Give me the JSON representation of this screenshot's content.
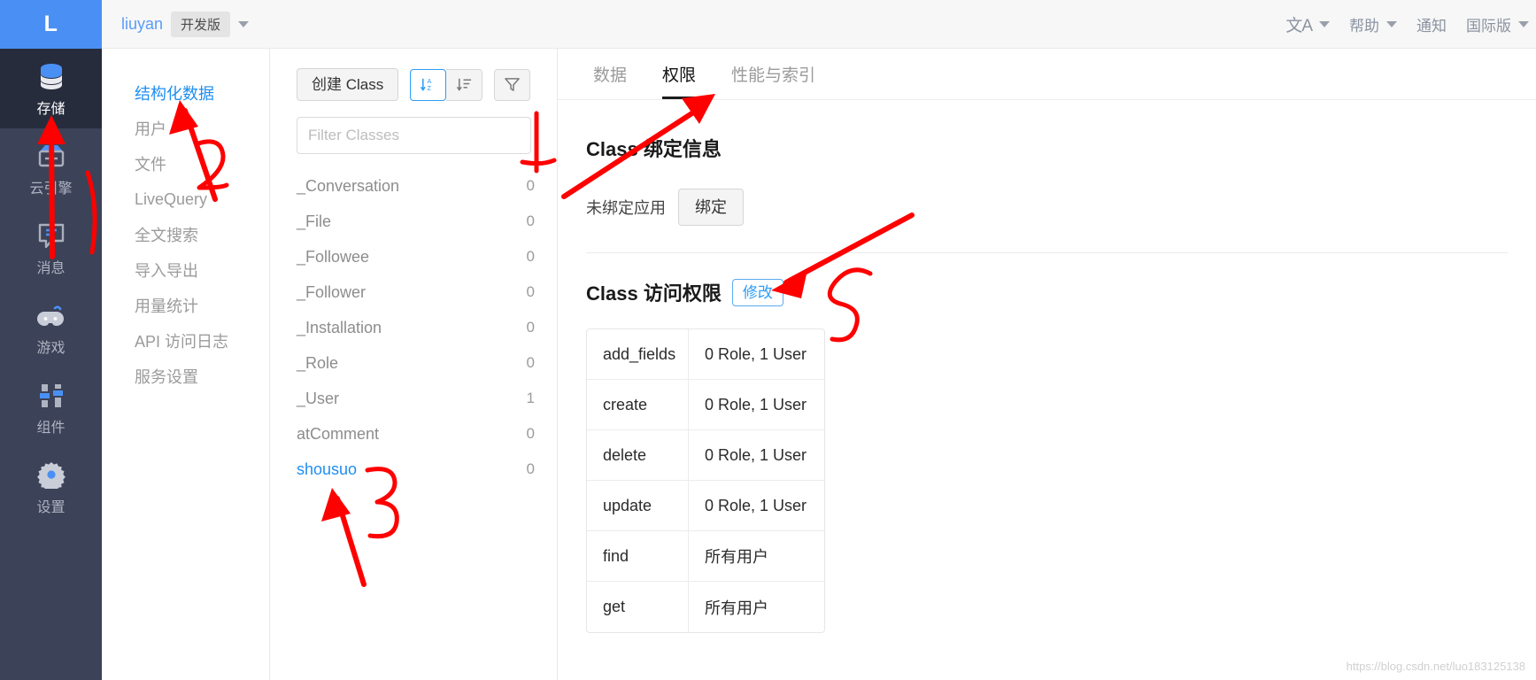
{
  "header": {
    "logo_letter": "L",
    "app_name": "liuyan",
    "env_badge": "开发版",
    "lang_glyph": "文A",
    "help": "帮助",
    "notifications": "通知",
    "international": "国际版"
  },
  "rail": {
    "items": [
      {
        "label": "存储",
        "icon": "database-icon",
        "active": true
      },
      {
        "label": "云引擎",
        "icon": "engine-icon",
        "active": false
      },
      {
        "label": "消息",
        "icon": "message-icon",
        "active": false
      },
      {
        "label": "游戏",
        "icon": "gamepad-icon",
        "active": false
      },
      {
        "label": "组件",
        "icon": "sliders-icon",
        "active": false
      },
      {
        "label": "设置",
        "icon": "gear-icon",
        "active": false
      }
    ]
  },
  "nav2": {
    "items": [
      {
        "label": "结构化数据",
        "active": true
      },
      {
        "label": "用户",
        "active": false
      },
      {
        "label": "文件",
        "active": false
      },
      {
        "label": "LiveQuery",
        "active": false
      },
      {
        "label": "全文搜索",
        "active": false
      },
      {
        "label": "导入导出",
        "active": false
      },
      {
        "label": "用量统计",
        "active": false
      },
      {
        "label": "API 访问日志",
        "active": false
      },
      {
        "label": "服务设置",
        "active": false
      }
    ]
  },
  "class_panel": {
    "create_button": "创建 Class",
    "sort_alpha_icon": "sort-alpha-icon",
    "sort_list_icon": "sort-list-icon",
    "filter_icon": "funnel-icon",
    "filter_placeholder": "Filter Classes",
    "filter_value": "",
    "classes": [
      {
        "name": "_Conversation",
        "count": "0",
        "custom": false
      },
      {
        "name": "_File",
        "count": "0",
        "custom": false
      },
      {
        "name": "_Followee",
        "count": "0",
        "custom": false
      },
      {
        "name": "_Follower",
        "count": "0",
        "custom": false
      },
      {
        "name": "_Installation",
        "count": "0",
        "custom": false
      },
      {
        "name": "_Role",
        "count": "0",
        "custom": false
      },
      {
        "name": "_User",
        "count": "1",
        "custom": false
      },
      {
        "name": "atComment",
        "count": "0",
        "custom": false
      },
      {
        "name": "shousuo",
        "count": "0",
        "custom": true
      }
    ]
  },
  "main": {
    "tabs": [
      {
        "label": "数据",
        "active": false
      },
      {
        "label": "权限",
        "active": true
      },
      {
        "label": "性能与索引",
        "active": false
      }
    ],
    "binding": {
      "title": "Class 绑定信息",
      "status": "未绑定应用",
      "bind_button": "绑定"
    },
    "acl": {
      "title": "Class 访问权限",
      "edit_button": "修改",
      "rows": [
        {
          "key": "add_fields",
          "value": "0 Role, 1 User"
        },
        {
          "key": "create",
          "value": "0 Role, 1 User"
        },
        {
          "key": "delete",
          "value": "0 Role, 1 User"
        },
        {
          "key": "update",
          "value": "0 Role, 1 User"
        },
        {
          "key": "find",
          "value": "所有用户"
        },
        {
          "key": "get",
          "value": "所有用户"
        }
      ]
    }
  },
  "annotations": {
    "marks": [
      "1",
      "2",
      "3",
      "4",
      "5"
    ],
    "color": "#ff0000"
  },
  "watermark": "https://blog.csdn.net/luo183125138",
  "colors": {
    "brand_blue": "#4a90f4",
    "link_blue": "#1f8ef1",
    "rail_bg": "#3c4257",
    "rail_active": "#272c3d",
    "annotation_red": "#ff0000"
  }
}
